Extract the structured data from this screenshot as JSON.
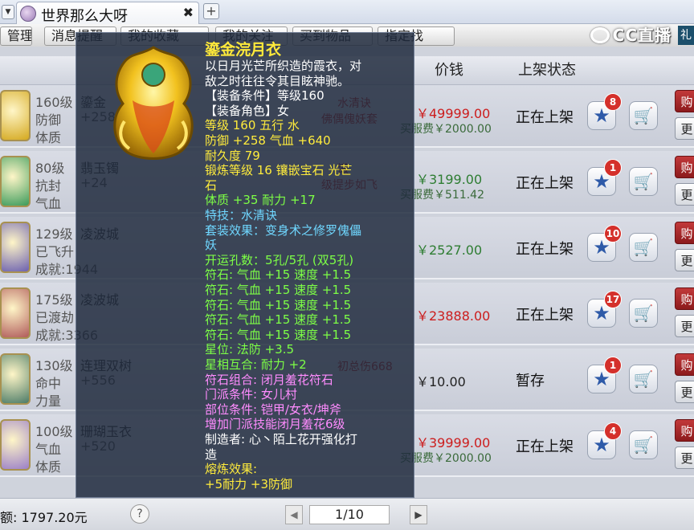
{
  "browser": {
    "tab_title": "世界那么大呀",
    "close_glyph": "✖",
    "new_tab_glyph": "+",
    "arrow_glyph": "▼"
  },
  "toolbar": {
    "buttons": [
      "管理",
      "消息提醒",
      "我的收藏",
      "我的关注",
      "买到物品",
      "指定找"
    ],
    "logo_text": "CC直播",
    "corner_text": "礼"
  },
  "list": {
    "columns": {
      "price": "价钱",
      "status": "上架状态"
    },
    "rows": [
      {
        "level": "160级",
        "name": "鎏金",
        "stat1": "防御",
        "stat2": "体质",
        "extra": "+258",
        "price": "￥49999.00",
        "price_color": "#cc1d1d",
        "fee": "买服费￥2000.00",
        "status": "正在上架",
        "fav": "8",
        "note": "水清诀",
        "note2": "佛偶傀妖套"
      },
      {
        "level": "80级",
        "name": "翡玉镯",
        "stat1": "抗封",
        "stat2": "气血",
        "extra": "+24",
        "price": "￥3199.00",
        "price_color": "#2e7d32",
        "fee": "买服费￥511.42",
        "status": "正在上架",
        "fav": "1",
        "note": "锻",
        "note2": "级提步如飞"
      },
      {
        "level": "129级",
        "name": "凌波城",
        "stat1": "已飞升",
        "stat2": "成就:1944",
        "extra": "",
        "price": "￥2527.00",
        "price_color": "#2e7d32",
        "fee": "",
        "status": "正在上架",
        "fav": "10",
        "note": "",
        "note2": ""
      },
      {
        "level": "175级",
        "name": "凌波城",
        "stat1": "已渡劫",
        "stat2": "成就:3366",
        "extra": "",
        "price": "￥23888.00",
        "price_color": "#cc1d1d",
        "fee": "",
        "status": "正在上架",
        "fav": "17",
        "note": "",
        "note2": ""
      },
      {
        "level": "130级",
        "name": "连理双树",
        "stat1": "命中",
        "stat2": "力量",
        "extra": "+556",
        "price": "￥10.00",
        "price_color": "#222222",
        "fee": "",
        "status": "暂存",
        "fav": "1",
        "note": "初总伤668",
        "note2": ""
      },
      {
        "level": "100级",
        "name": "珊瑚玉衣",
        "stat1": "气血",
        "stat2": "体质",
        "extra": "+520",
        "price": "￥39999.00",
        "price_color": "#cc1d1d",
        "fee": "买服费￥2000.00",
        "status": "正在上架",
        "fav": "4",
        "note": "",
        "note2": ""
      }
    ],
    "buy_label": "购",
    "more_label": "更"
  },
  "footer": {
    "balance": "额: 1797.20元",
    "help": "?",
    "page": "1/10",
    "prev": "◀",
    "next": "▶"
  },
  "tooltip": {
    "name": "鎏金浣月衣",
    "lines": [
      {
        "text": "以日月光芒所织造的霞衣，对",
        "color": "w"
      },
      {
        "text": "敌之时往往令其目眩神驰。",
        "color": "w"
      },
      {
        "text": "【装备条件】等级160",
        "color": "w"
      },
      {
        "text": "【装备角色】女",
        "color": "w"
      },
      {
        "text": "等级 160  五行 水",
        "color": "y"
      },
      {
        "text": "防御 +258  气血 +640",
        "color": "y"
      },
      {
        "text": "耐久度 79",
        "color": "y"
      },
      {
        "text": "锻炼等级 16   镶嵌宝石 光芒",
        "color": "y"
      },
      {
        "text": "石",
        "color": "y"
      },
      {
        "text": "体质 +35 耐力 +17",
        "color": "g"
      },
      {
        "text": "特技：水清诀",
        "color": "b"
      },
      {
        "text": "套装效果：变身术之修罗傀儡",
        "color": "b"
      },
      {
        "text": "妖",
        "color": "b"
      },
      {
        "text": "开运孔数：5孔/5孔 (双5孔)",
        "color": "g"
      },
      {
        "text": "符石: 气血 +15 速度 +1.5",
        "color": "g"
      },
      {
        "text": "符石: 气血 +15 速度 +1.5",
        "color": "g"
      },
      {
        "text": "符石: 气血 +15 速度 +1.5",
        "color": "g"
      },
      {
        "text": "符石: 气血 +15 速度 +1.5",
        "color": "g"
      },
      {
        "text": "符石: 气血 +15 速度 +1.5",
        "color": "g"
      },
      {
        "text": "星位: 法防 +3.5",
        "color": "g"
      },
      {
        "text": "星相互合: 耐力 +2",
        "color": "g"
      },
      {
        "text": "符石组合: 闭月羞花符石",
        "color": "p"
      },
      {
        "text": "门派条件: 女儿村",
        "color": "p"
      },
      {
        "text": "部位条件: 铠甲/女衣/坤斧",
        "color": "p"
      },
      {
        "text": "增加门派技能闭月羞花6级",
        "color": "p"
      },
      {
        "text": "制造者: 心丶陌上花开强化打",
        "color": "w"
      },
      {
        "text": "造",
        "color": "w"
      },
      {
        "text": "熔炼效果:",
        "color": "y"
      },
      {
        "text": "+5耐力 +3防御",
        "color": "y"
      }
    ]
  }
}
